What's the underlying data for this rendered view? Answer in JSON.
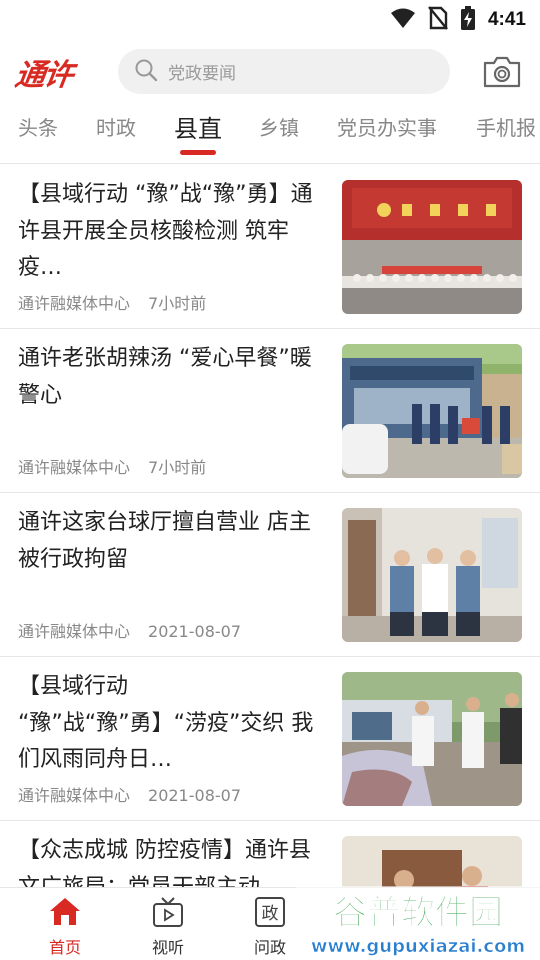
{
  "status_bar": {
    "time": "4:41",
    "icons": [
      "wifi-icon",
      "no-sim-icon",
      "battery-charging-icon"
    ]
  },
  "header": {
    "logo_text": "通许",
    "search_placeholder": "党政要闻",
    "icons": [
      "search-icon",
      "camera-icon"
    ]
  },
  "tabs": [
    {
      "label": "头条",
      "active": false
    },
    {
      "label": "时政",
      "active": false
    },
    {
      "label": "县直",
      "active": true
    },
    {
      "label": "乡镇",
      "active": false
    },
    {
      "label": "党员办实事",
      "active": false
    },
    {
      "label": "手机报",
      "active": false
    }
  ],
  "accent_color": "#d82a22",
  "news": [
    {
      "title": "【县域行动 “豫”战“豫”勇】通许县开展全员核酸检测 筑牢疫…",
      "source": "通许融媒体中心",
      "time": "7小时前"
    },
    {
      "title": "通许老张胡辣汤 “爱心早餐”暖警心",
      "source": "通许融媒体中心",
      "time": "7小时前"
    },
    {
      "title": "通许这家台球厅擅自营业 店主被行政拘留",
      "source": "通许融媒体中心",
      "time": "2021-08-07"
    },
    {
      "title": "【县域行动 “豫”战“豫”勇】“涝疫”交织 我们风雨同舟日…",
      "source": "通许融媒体中心",
      "time": "2021-08-07"
    },
    {
      "title": "【众志成城 防控疫情】通许县文广旅局：党员干部主动…",
      "source": "",
      "time": ""
    }
  ],
  "bottom_nav": [
    {
      "label": "首页",
      "icon": "home-icon",
      "active": true
    },
    {
      "label": "视听",
      "icon": "tv-icon",
      "active": false
    },
    {
      "label": "问政",
      "icon": "zheng-icon",
      "active": false
    }
  ],
  "watermark": {
    "brand": "谷普软件园",
    "url": "www.gupuxiazai.com"
  }
}
